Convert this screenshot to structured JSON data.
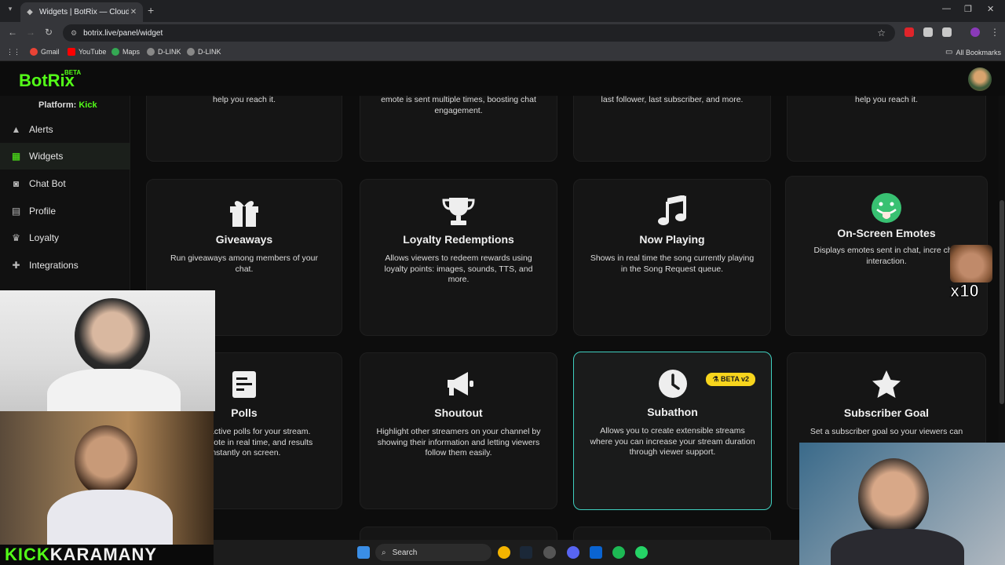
{
  "browser": {
    "tab_title": "Widgets | BotRix — Cloud Stre...",
    "url": "botrix.live/panel/widget",
    "bookmarks": [
      "Gmail",
      "YouTube",
      "Maps",
      "D-LINK",
      "D-LINK"
    ],
    "all_bookmarks": "All Bookmarks",
    "ext_colors": [
      "#e0242a",
      "#c8c8c8",
      "#c8c8c8",
      "#8a3ab9"
    ]
  },
  "app": {
    "logo": "BotRix",
    "beta": "BETA",
    "platform_label": "Platform:",
    "platform_value": "Kick",
    "accent": "#53fc18"
  },
  "sidebar": {
    "items": [
      {
        "label": "Alerts",
        "icon": "warning-icon"
      },
      {
        "label": "Widgets",
        "icon": "grid-icon",
        "active": true
      },
      {
        "label": "Chat Bot",
        "icon": "robot-icon"
      },
      {
        "label": "Profile",
        "icon": "id-card-icon"
      },
      {
        "label": "Loyalty",
        "icon": "trophy-icon"
      },
      {
        "label": "Integrations",
        "icon": "puzzle-icon"
      }
    ]
  },
  "cards_top_partial": [
    {
      "text": "help you reach it."
    },
    {
      "text": "emote is sent multiple times, boosting chat engagement."
    },
    {
      "text": "last follower, last subscriber, and more."
    },
    {
      "text": "help you reach it."
    }
  ],
  "cards_row1": [
    {
      "title": "Giveaways",
      "desc": "Run giveaways among members of your chat.",
      "icon": "gift-icon"
    },
    {
      "title": "Loyalty Redemptions",
      "desc": "Allows viewers to redeem rewards using loyalty points: images, sounds, TTS, and more.",
      "icon": "trophy-icon"
    },
    {
      "title": "Now Playing",
      "desc": "Shows in real time the song currently playing in the Song Request queue.",
      "icon": "music-note-icon"
    },
    {
      "title": "On-Screen Emotes",
      "desc": "Displays emotes sent in chat, incre chat interaction.",
      "icon": "tongue-emoji-icon"
    }
  ],
  "cards_row2": [
    {
      "title": "Polls",
      "desc": "active polls for your stream. vote in real time, and results instantly on screen.",
      "icon": "poll-icon"
    },
    {
      "title": "Shoutout",
      "desc": "Highlight other streamers on your channel by showing their information and letting viewers follow them easily.",
      "icon": "megaphone-icon"
    },
    {
      "title": "Subathon",
      "desc": "Allows you to create extensible streams where you can increase your stream duration through viewer support.",
      "icon": "clock-icon",
      "badge": "BETA v2"
    },
    {
      "title": "Subscriber Goal",
      "desc": "Set a subscriber goal so your viewers can",
      "icon": "star-icon"
    }
  ],
  "overlay": {
    "kick": "KICK",
    "name": "KARAMANY",
    "emote_multiplier": "x10"
  },
  "taskbar": {
    "search": "Search"
  }
}
